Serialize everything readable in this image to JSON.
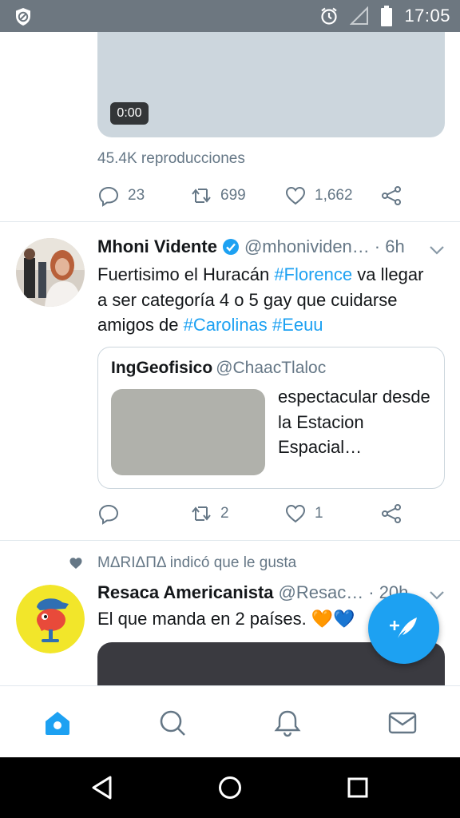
{
  "status_bar": {
    "time": "17:05",
    "icons": [
      "blocked-shield-icon",
      "alarm-icon",
      "signal-icon",
      "battery-icon"
    ]
  },
  "feed": {
    "prev_tweet": {
      "video_duration": "0:00",
      "views": "45.4K reproducciones",
      "reply_count": "23",
      "retweet_count": "699",
      "like_count": "1,662"
    },
    "tweet_1": {
      "name": "Mhoni Vidente",
      "handle": "@mhonividen…",
      "time": "· 6h",
      "text_part1": "Fuertisimo el Huracán ",
      "tag1": "#Florence",
      "text_part2": " va llegar a ser categoría 4 o 5 gay que cuidarse amigos de ",
      "tag2": "#Carolinas",
      "text_part3": " ",
      "tag3": "#Eeuu",
      "quote": {
        "name": "IngGeofisico",
        "handle": "@ChaacTlaloc",
        "text": "espectacular desde la Estacion Espacial…"
      },
      "reply_count": "",
      "retweet_count": "2",
      "like_count": "1"
    },
    "tweet_2": {
      "social_context": "MΔRIΔПΔ indicó que le gusta",
      "name": "Resaca Americanista",
      "handle": "@Resac…",
      "time": "· 20h",
      "text": "El que manda en 2 países. 🧡💙"
    }
  },
  "colors": {
    "accent": "#1da1f2",
    "muted": "#657786",
    "status_bar": "#6d7780"
  }
}
